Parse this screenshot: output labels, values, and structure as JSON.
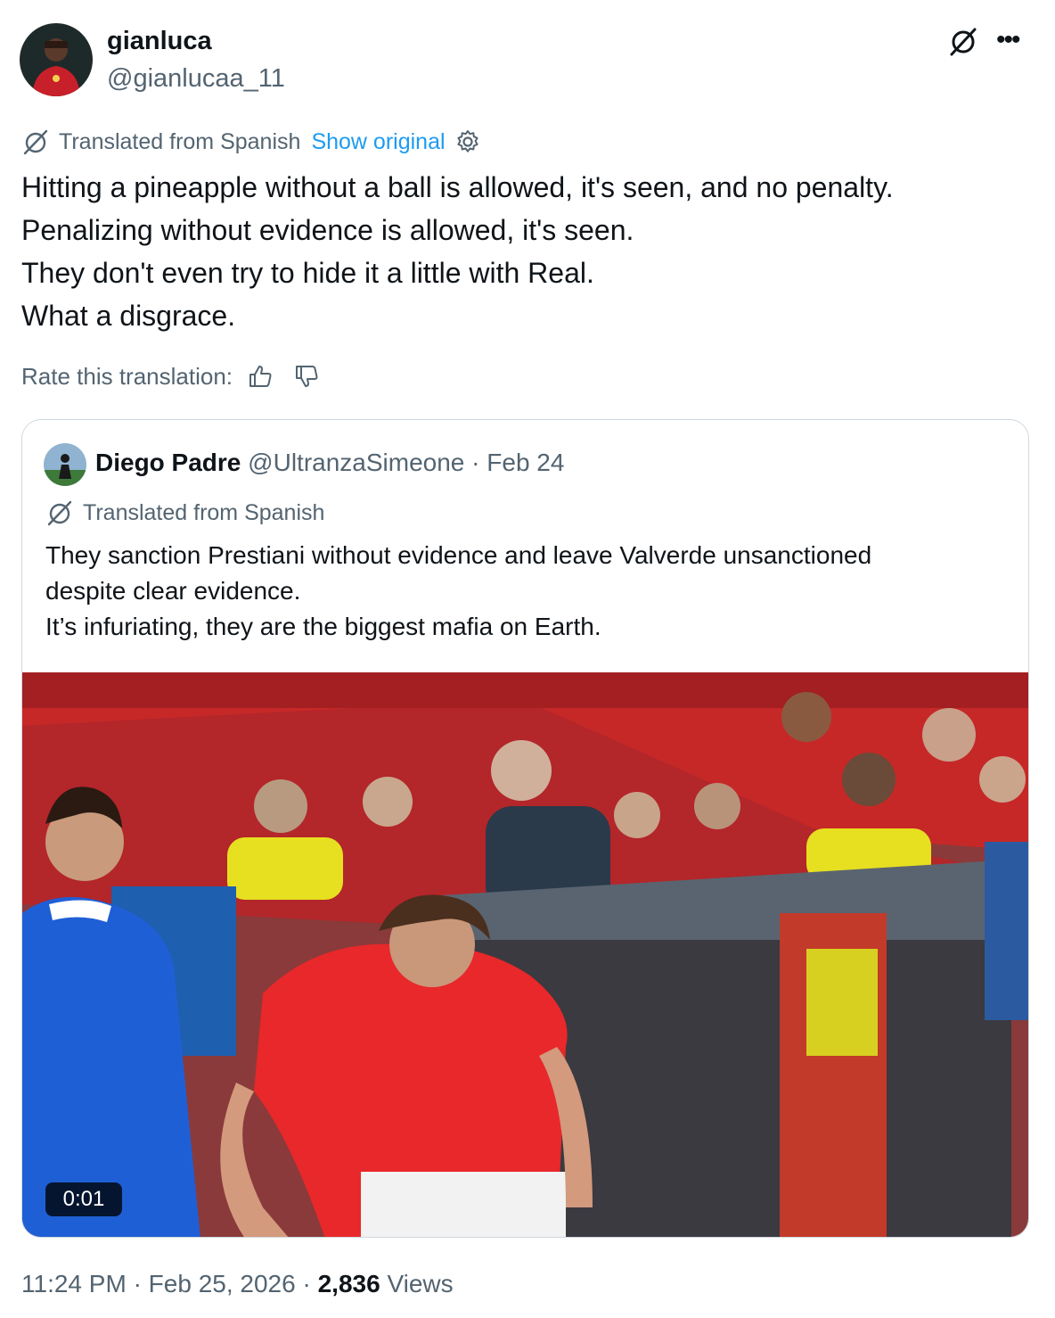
{
  "author": {
    "name": "gianluca",
    "handle": "@gianlucaa_11"
  },
  "translation_bar": {
    "label": "Translated from Spanish",
    "show_original": "Show original"
  },
  "tweet_lines": [
    "Hitting a pineapple without a ball is allowed, it's seen, and no penalty.",
    "Penalizing without evidence is allowed, it's seen.",
    "They don't even try to hide it a little with Real.",
    "What a disgrace."
  ],
  "rate": {
    "label": "Rate this translation:"
  },
  "quote": {
    "name": "Diego Padre",
    "handle": "@UltranzaSimeone",
    "separator": "·",
    "date": "Feb 24",
    "translated_label": "Translated from Spanish",
    "lines": [
      "They sanction Prestiani without evidence and leave Valverde unsanctioned",
      "despite clear evidence.",
      "It’s infuriating, they are the biggest mafia on Earth."
    ],
    "video_time": "0:01"
  },
  "footer": {
    "time": "11:24 PM",
    "date": "Feb 25, 2026",
    "separator": "·",
    "views_count": "2,836",
    "views_label": "Views"
  },
  "colors": {
    "link": "#1d9bf0",
    "secondary_text": "#536471",
    "border": "#cfd9de"
  },
  "icons": {
    "grok": "grok-icon",
    "more": "more-icon",
    "translate": "translate-icon",
    "settings": "gear-icon",
    "thumbs_up": "thumbs-up-icon",
    "thumbs_down": "thumbs-down-icon"
  }
}
